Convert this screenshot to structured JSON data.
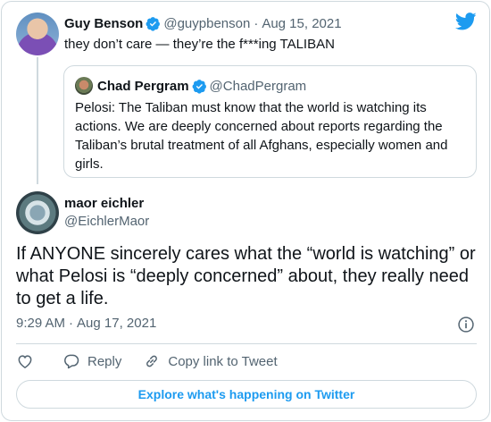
{
  "colors": {
    "accent": "#1d9bf0",
    "verified": "#1d9bf0",
    "muted": "#536471",
    "border": "#cfd9de",
    "text": "#0f1419"
  },
  "icons": {
    "brand": "twitter-bird-icon",
    "verified": "verified-badge-icon",
    "info": "info-icon",
    "like": "heart-icon",
    "reply": "reply-bubble-icon",
    "copy": "link-icon"
  },
  "parent_tweet": {
    "author_name": "Guy Benson",
    "author_handle": "@guypbenson",
    "separator": "·",
    "date": "Aug 15, 2021",
    "text": "they don’t care — they’re the f***ing TALIBAN"
  },
  "quoted_tweet": {
    "author_name": "Chad Pergram",
    "author_handle": "@ChadPergram",
    "text": "Pelosi: The Taliban must know that the world is watching its actions. We are deeply concerned about reports regarding the Taliban’s brutal treatment of all Afghans, especially women and girls."
  },
  "main_tweet": {
    "author_name": "maor eichler",
    "author_handle": "@EichlerMaor",
    "text": "If ANYONE sincerely cares what the “world is watching” or what Pelosi is “deeply concerned” about, they really need to get a life.",
    "time": "9:29 AM",
    "separator": "·",
    "date": "Aug 17, 2021"
  },
  "actions": {
    "reply_label": "Reply",
    "copy_label": "Copy link to Tweet"
  },
  "explore_label": "Explore what's happening on Twitter"
}
